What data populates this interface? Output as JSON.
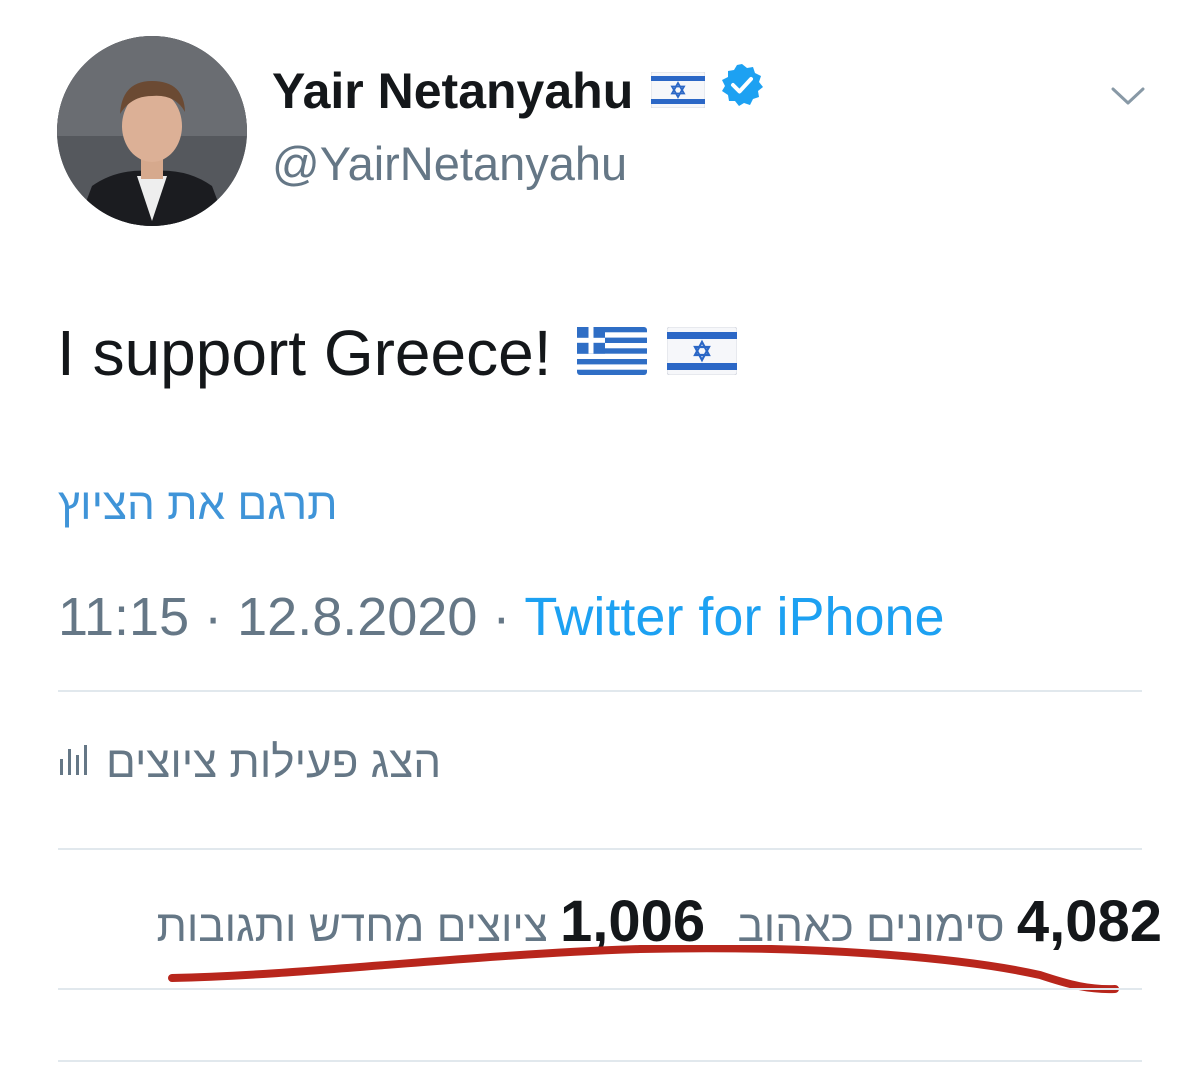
{
  "user": {
    "display_name": "Yair Netanyahu",
    "handle": "@YairNetanyahu",
    "verified": true
  },
  "tweet": {
    "text": "I support Greece!",
    "translate_label": "תרגם את הציוץ",
    "time": "11:15",
    "separator": "·",
    "date": "12.8.2020",
    "source": "Twitter for iPhone"
  },
  "activity": {
    "label": "הצג פעילות ציוצים"
  },
  "stats": {
    "likes_count": "4,082",
    "likes_label": "סימונים כאהוב",
    "retweets_count": "1,006",
    "retweets_label": "ציוצים מחדש ותגובות"
  },
  "colors": {
    "link": "#1da1f2",
    "secondary_text": "#657786",
    "verified_badge": "#1da1f2",
    "annotation": "#b8261c"
  }
}
